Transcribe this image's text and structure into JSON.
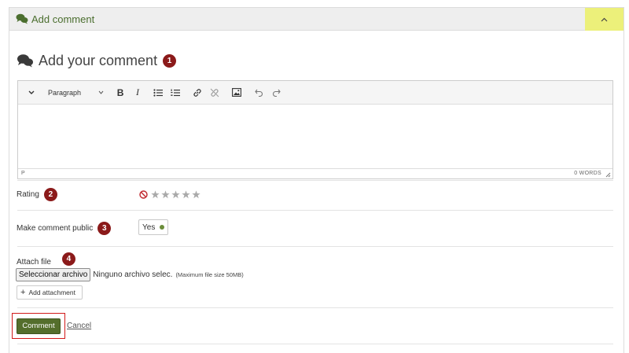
{
  "panel": {
    "header_title": "Add comment",
    "collapse_icon": "chevron-up-icon",
    "header_icon": "comments-icon",
    "accent_color": "#ecf07a"
  },
  "title": {
    "text": "Add your comment",
    "badge": "1"
  },
  "editor": {
    "toolbar": {
      "menu_toggle_icon": "chevron-down-icon",
      "block_format": "Paragraph",
      "bold_label": "B",
      "italic_label": "I",
      "icons": [
        "bullet-list-icon",
        "numbered-list-icon",
        "link-icon",
        "unlink-icon",
        "image-icon",
        "undo-icon",
        "redo-icon"
      ]
    },
    "path": "P",
    "word_count": "0 WORDS"
  },
  "rating": {
    "label": "Rating",
    "badge": "2",
    "max_stars": 5,
    "value": 0
  },
  "public": {
    "label": "Make comment public",
    "badge": "3",
    "toggle_value": "Yes",
    "toggle_color": "#6b8d3a"
  },
  "attach": {
    "label": "Attach file",
    "badge": "4",
    "choose_button": "Seleccionar archivo",
    "no_file_text": "Ninguno archivo selec.",
    "size_hint": "(Maximum file size 50MB)",
    "add_button": "Add attachment"
  },
  "actions": {
    "submit_label": "Comment",
    "cancel_label": "Cancel",
    "submit_color": "#546e2c",
    "highlight_color": "#d11a1a"
  }
}
